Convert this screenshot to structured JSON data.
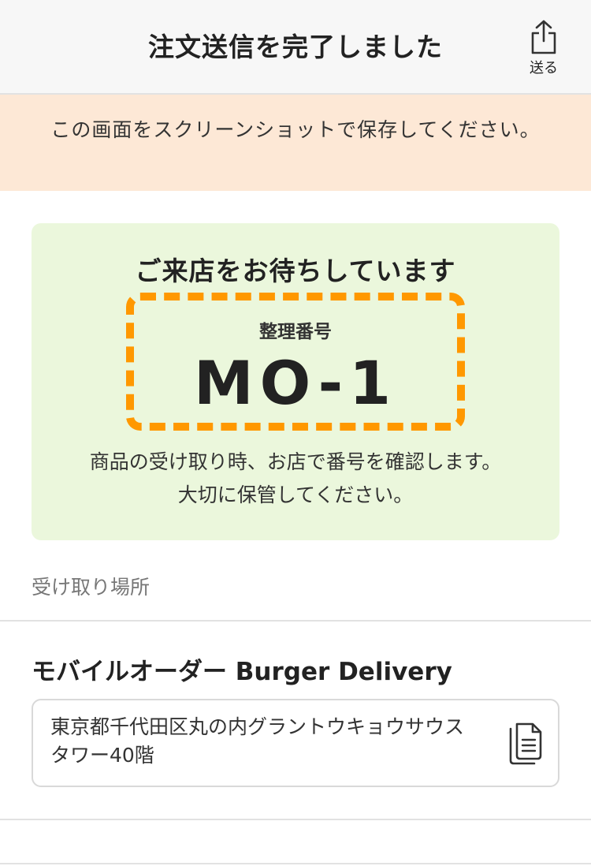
{
  "header": {
    "title": "注文送信を完了しました",
    "share_label": "送る"
  },
  "notice": {
    "text": "この画面をスクリーンショットで保存してください。"
  },
  "ticket": {
    "heading": "ご来店をお待ちしています",
    "number_label": "整理番号",
    "number": "MO-1",
    "note_line1": "商品の受け取り時、お店で番号を確認します。",
    "note_line2": "大切に保管してください。"
  },
  "pickup": {
    "section_label": "受け取り場所",
    "store_name": "モバイルオーダー Burger Delivery",
    "address": "東京都千代田区丸の内グラントウキョウサウスタワー40階"
  },
  "colors": {
    "header_bg": "#f7f7f7",
    "notice_bg": "#fde8d6",
    "ticket_bg": "#ebf7dc",
    "accent_dashed_border": "#ff9800"
  },
  "icons": {
    "share": "share-icon",
    "copy": "copy-icon"
  }
}
